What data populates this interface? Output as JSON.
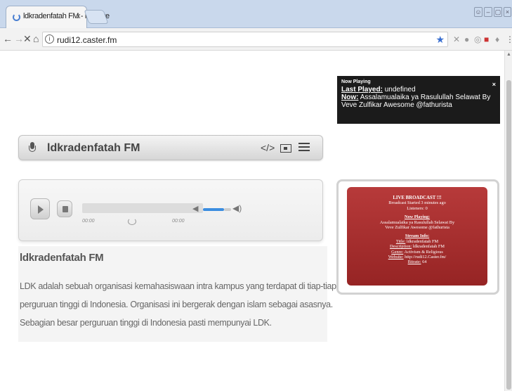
{
  "browser": {
    "tab_title": "ldkradenfatah FM - Powere",
    "tab_close": "x",
    "url": "rudi12.caster.fm",
    "info_glyph": "i",
    "bookmark_glyph": "★"
  },
  "now_playing_popup": {
    "title": "Now Playing",
    "close": "×",
    "last_played_label": "Last Played:",
    "last_played_value": "undefined",
    "now_label": "Now:",
    "now_value": "Assalamualaika ya Rasulullah Selawat By Veve Zulfikar Awesome @fathurista"
  },
  "player": {
    "station_name": "ldkradenfatah FM",
    "current_time": "00:00",
    "duration": "00:00",
    "volume_fraction": 0.75,
    "accent_color": "#3b8de0"
  },
  "description": {
    "title": "ldkradenfatah FM",
    "lines": [
      "LDK adalah sebuah organisasi kemahasiswaan intra kampus yang terdapat di tiap-tiap",
      "perguruan tinggi di Indonesia. Organisasi ini bergerak dengan islam sebagai asasnya.",
      "Sebagian besar perguruan tinggi di Indonesia pasti mempunyai LDK."
    ]
  },
  "live_widget": {
    "heading": "LIVE BROADCAST !!!",
    "started": "Broadcast Started 3 minutes ago",
    "listeners": "Listeners: 0",
    "now_playing_heading": "Now Playing:",
    "now_playing_line1": "Assalamualaika ya Rasulullah Selawat By",
    "now_playing_line2": "Veve Zulfikar Awesome @fathurista",
    "stream_info_heading": "Stream Info:",
    "title_label": "Title:",
    "title_value": "ldkradenfatah FM",
    "description_label": "Description:",
    "description_value": "ldkradenfatah FM",
    "genre_label": "Genre:",
    "genre_value": "Activism & Religious",
    "website_label": "Website:",
    "website_value": "http://rudi12.Caster.fm/",
    "bitrate_label": "Bitrate:",
    "bitrate_value": "64",
    "color": "#a82f2f"
  }
}
